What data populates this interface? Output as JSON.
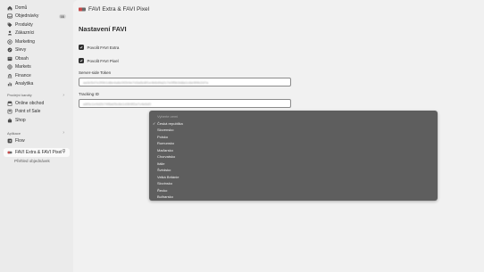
{
  "sidebar": {
    "items": [
      {
        "label": "Domů",
        "icon": "home-icon"
      },
      {
        "label": "Objednávky",
        "icon": "inbox-icon",
        "badge": "55"
      },
      {
        "label": "Produkty",
        "icon": "tag-icon"
      },
      {
        "label": "Zákazníci",
        "icon": "person-icon"
      },
      {
        "label": "Marketing",
        "icon": "target-icon"
      },
      {
        "label": "Slevy",
        "icon": "discount-icon"
      },
      {
        "label": "Obsah",
        "icon": "content-icon"
      },
      {
        "label": "Markets",
        "icon": "globe-icon"
      },
      {
        "label": "Finance",
        "icon": "bank-icon"
      },
      {
        "label": "Analytika",
        "icon": "chart-icon"
      }
    ],
    "sales_channels": {
      "title": "Prodejní kanály",
      "items": [
        {
          "label": "Online obchod",
          "icon": "store-icon"
        },
        {
          "label": "Point of Sale",
          "icon": "pos-icon"
        },
        {
          "label": "Shop",
          "icon": "bag-icon"
        }
      ]
    },
    "apps": {
      "title": "Aplikace",
      "items": [
        {
          "label": "Flow",
          "icon": "flow-icon"
        }
      ],
      "active": {
        "label": "FAVI Extra & FAVI Pixel",
        "icon": "favi-icon"
      },
      "sub_item": "Přehled objednávek"
    }
  },
  "topbar": {
    "title": "FAVI Extra & FAVI Pixel"
  },
  "main": {
    "page_title": "Nastavení FAVI",
    "checkbox_extra": "Povolit FAVI Extra",
    "checkbox_pixel": "Povolit FAVI Pixel",
    "token_label": "Server-side Token",
    "token_value": "aa3c5d7e2f9b1d8e4a6c0f2b9e7d3a5c8f1e4b6d9a2c7e0f5b3d8a1c6e9f4b2d7a",
    "tracking_label": "Tracking ID",
    "tracking_value": "a8f3c1e9d2b74f6a05c8e1d3b9f2a7c4e6d0"
  },
  "dropdown": {
    "header": "Vyberte zemi",
    "selected": "Česká republika",
    "options": [
      "Česká republika",
      "Slovensko",
      "Polsko",
      "Rumunsko",
      "Maďarsko",
      "Chorvatsko",
      "Itálie",
      "Švédsko",
      "Velká Británie",
      "Slovinsko",
      "Řecko",
      "Bulharsko"
    ]
  },
  "colors": {
    "accent": "#4a6ed9",
    "dropdown_bg": "#5e5e5e",
    "sidebar_bg": "#ebebeb",
    "main_bg": "#f1f1f1"
  }
}
